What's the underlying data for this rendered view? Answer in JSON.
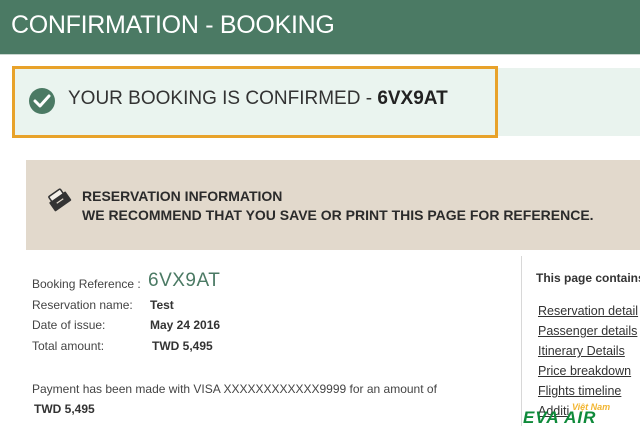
{
  "header": {
    "title": "CONFIRMATION - BOOKING"
  },
  "confirmation": {
    "icon": "check-circle-icon",
    "message": "YOUR BOOKING IS CONFIRMED - ",
    "code": "6VX9AT"
  },
  "reservation_panel": {
    "icon": "ticket-icon",
    "title": "RESERVATION INFORMATION",
    "subtitle": "WE RECOMMEND THAT YOU SAVE OR PRINT THIS PAGE FOR REFERENCE."
  },
  "details": {
    "booking_reference_label": "Booking Reference :",
    "booking_reference_value": "6VX9AT",
    "reservation_name_label": "Reservation name:",
    "reservation_name_value": "Test",
    "date_of_issue_label": "Date of issue:",
    "date_of_issue_value": "May 24 2016",
    "total_amount_label": "Total amount:",
    "total_amount_value": "TWD 5,495"
  },
  "payment": {
    "text": "Payment has been made with VISA XXXXXXXXXXXX9999 for an amount of",
    "amount": "TWD 5,495"
  },
  "sidebar": {
    "title": "This page contains",
    "links": [
      "Reservation detail",
      "Passenger details",
      "Itinerary Details",
      "Price breakdown",
      "Flights timeline",
      "Additi"
    ]
  },
  "watermark": {
    "line1": "Việt Nam",
    "line2": "EVA AIR"
  },
  "colors": {
    "header": "#4b7a64",
    "accent_border": "#e8a22a",
    "confirm_bg": "#eaf4ef",
    "panel_bg": "#e2d9cc"
  }
}
